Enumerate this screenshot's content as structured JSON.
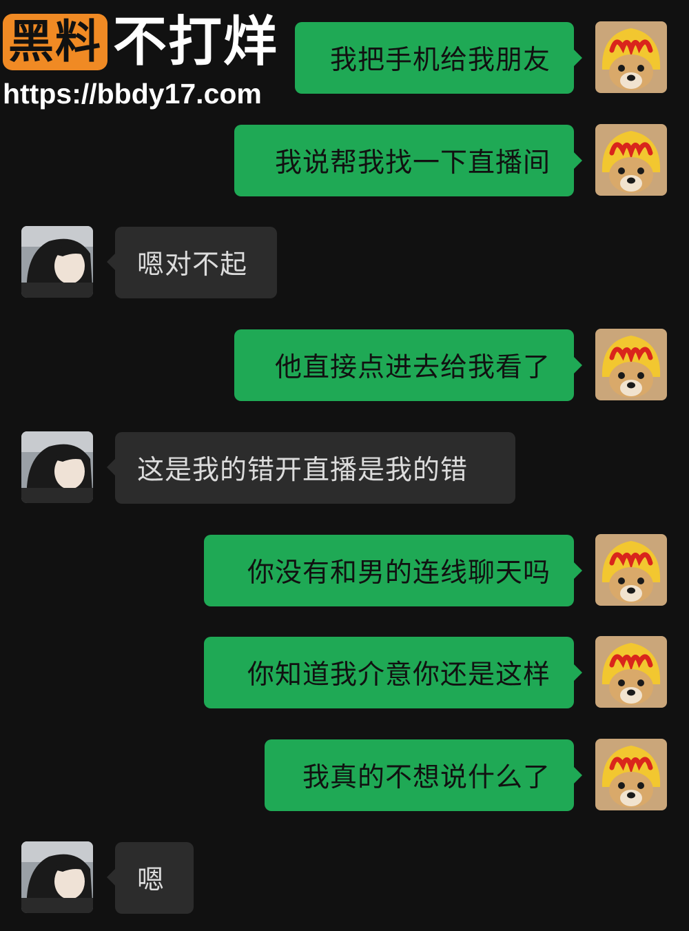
{
  "watermark": {
    "badge_text": "黑料",
    "title": "不打烊",
    "url": "https://bbdy17.com"
  },
  "avatars": {
    "self": "dog-avatar",
    "other": "girl-avatar"
  },
  "messages": [
    {
      "from": "self",
      "text": "我把手机给我朋友"
    },
    {
      "from": "self",
      "text": "我说帮我找一下直播间"
    },
    {
      "from": "other",
      "text": "嗯对不起"
    },
    {
      "from": "self",
      "text": "他直接点进去给我看了"
    },
    {
      "from": "other",
      "text": "这是我的错开直播是我的错"
    },
    {
      "from": "self",
      "text": "你没有和男的连线聊天吗"
    },
    {
      "from": "self",
      "text": "你知道我介意你还是这样"
    },
    {
      "from": "self",
      "text": "我真的不想说什么了"
    },
    {
      "from": "other",
      "text": "嗯"
    }
  ],
  "colors": {
    "background": "#111111",
    "outgoing_bubble": "#1fa955",
    "incoming_bubble": "#2c2c2c",
    "badge": "#f08a24"
  }
}
